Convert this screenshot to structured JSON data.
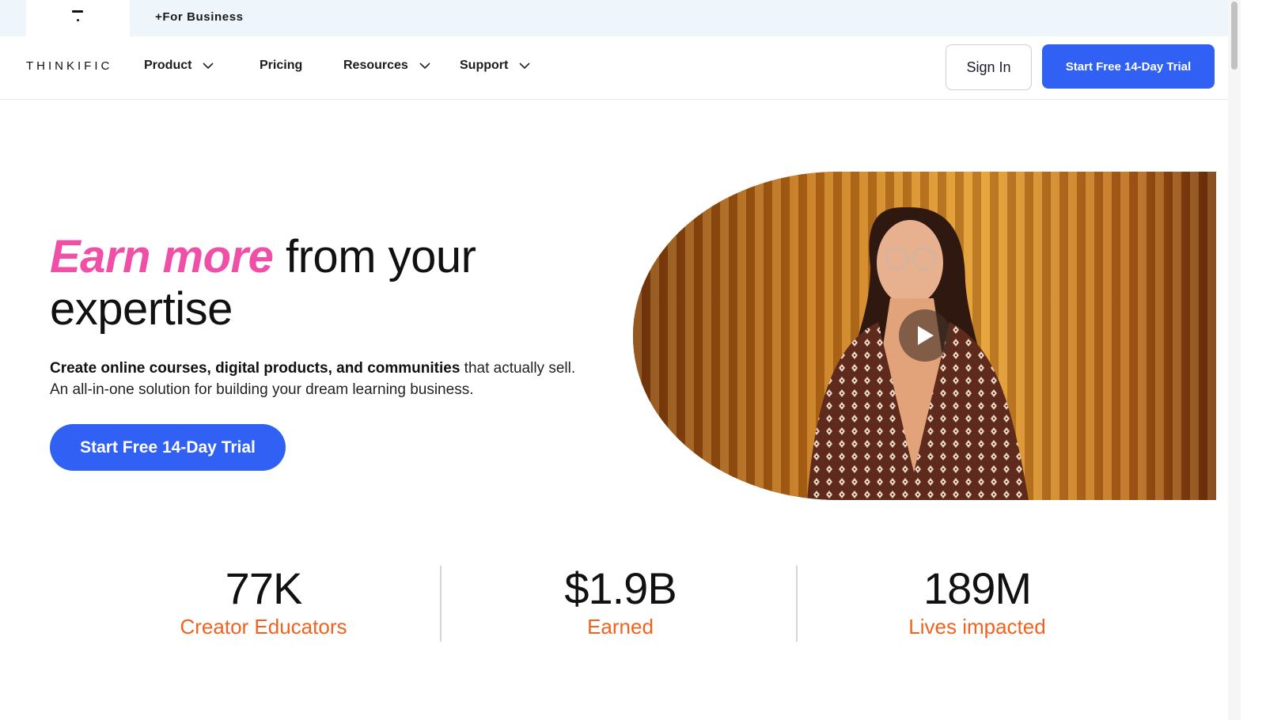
{
  "topbar": {
    "business_link": "+For Business"
  },
  "nav": {
    "logo": "THINKIFIC",
    "items": [
      {
        "label": "Product",
        "has_dropdown": true
      },
      {
        "label": "Pricing",
        "has_dropdown": false
      },
      {
        "label": "Resources",
        "has_dropdown": true
      },
      {
        "label": "Support",
        "has_dropdown": true
      }
    ],
    "sign_in": "Sign In",
    "trial": "Start Free 14-Day Trial"
  },
  "hero": {
    "title_accent": "Earn more",
    "title_rest": " from your expertise",
    "sub_bold": "Create online courses, digital products, and communities",
    "sub_rest": " that actually sell. An all-in-one solution for building your dream learning business.",
    "cta": "Start Free 14-Day Trial"
  },
  "stats": [
    {
      "value": "77K",
      "label": "Creator Educators"
    },
    {
      "value": "$1.9B",
      "label": "Earned"
    },
    {
      "value": "189M",
      "label": "Lives impacted"
    }
  ],
  "colors": {
    "accent_pink": "#f04fa8",
    "brand_blue": "#3160f5",
    "stat_orange": "#f0621e"
  }
}
